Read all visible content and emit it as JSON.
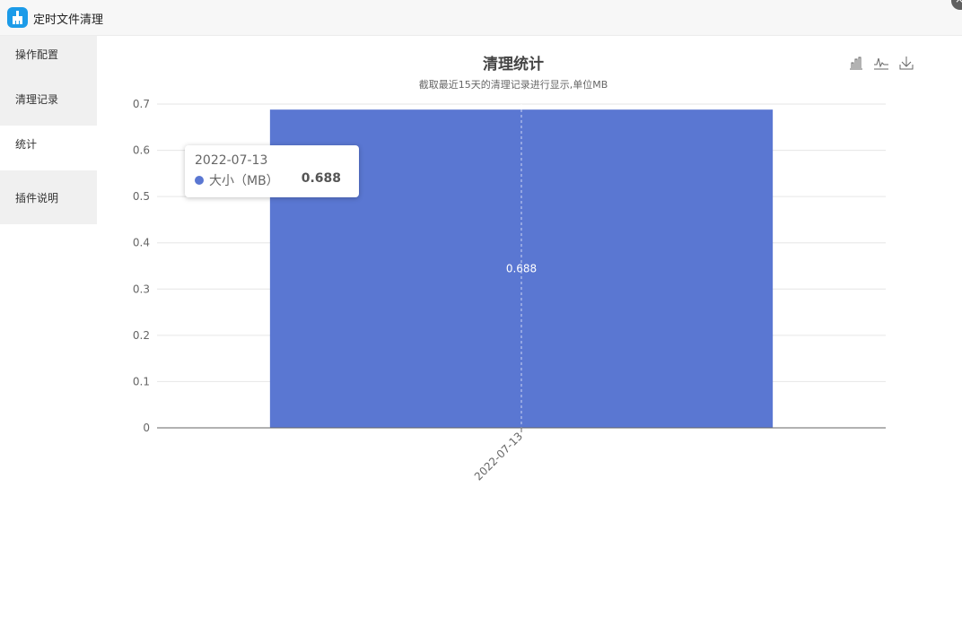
{
  "app": {
    "title": "定时文件清理"
  },
  "sidebar": {
    "items": [
      {
        "label": "操作配置"
      },
      {
        "label": "清理记录"
      },
      {
        "label": "统计"
      },
      {
        "label": "插件说明"
      }
    ]
  },
  "colors": {
    "bar": "#5a77d2",
    "accent": "#1c9be8"
  },
  "toolbox": {
    "icons": [
      "bar-chart-icon",
      "line-chart-icon",
      "download-icon"
    ]
  },
  "tooltip": {
    "date": "2022-07-13",
    "series": "大小（MB）",
    "value": "0.688"
  },
  "chart_data": {
    "type": "bar",
    "title": "清理统计",
    "subtitle": "截取最近15天的清理记录进行显示,单位MB",
    "categories": [
      "2022-07-13"
    ],
    "series": [
      {
        "name": "大小（MB）",
        "values": [
          0.688
        ]
      }
    ],
    "ylim": [
      0,
      0.7
    ],
    "yticks": [
      0,
      0.1,
      0.2,
      0.3,
      0.4,
      0.5,
      0.6,
      0.7
    ],
    "grid": true,
    "data_labels": [
      "0.688"
    ]
  }
}
